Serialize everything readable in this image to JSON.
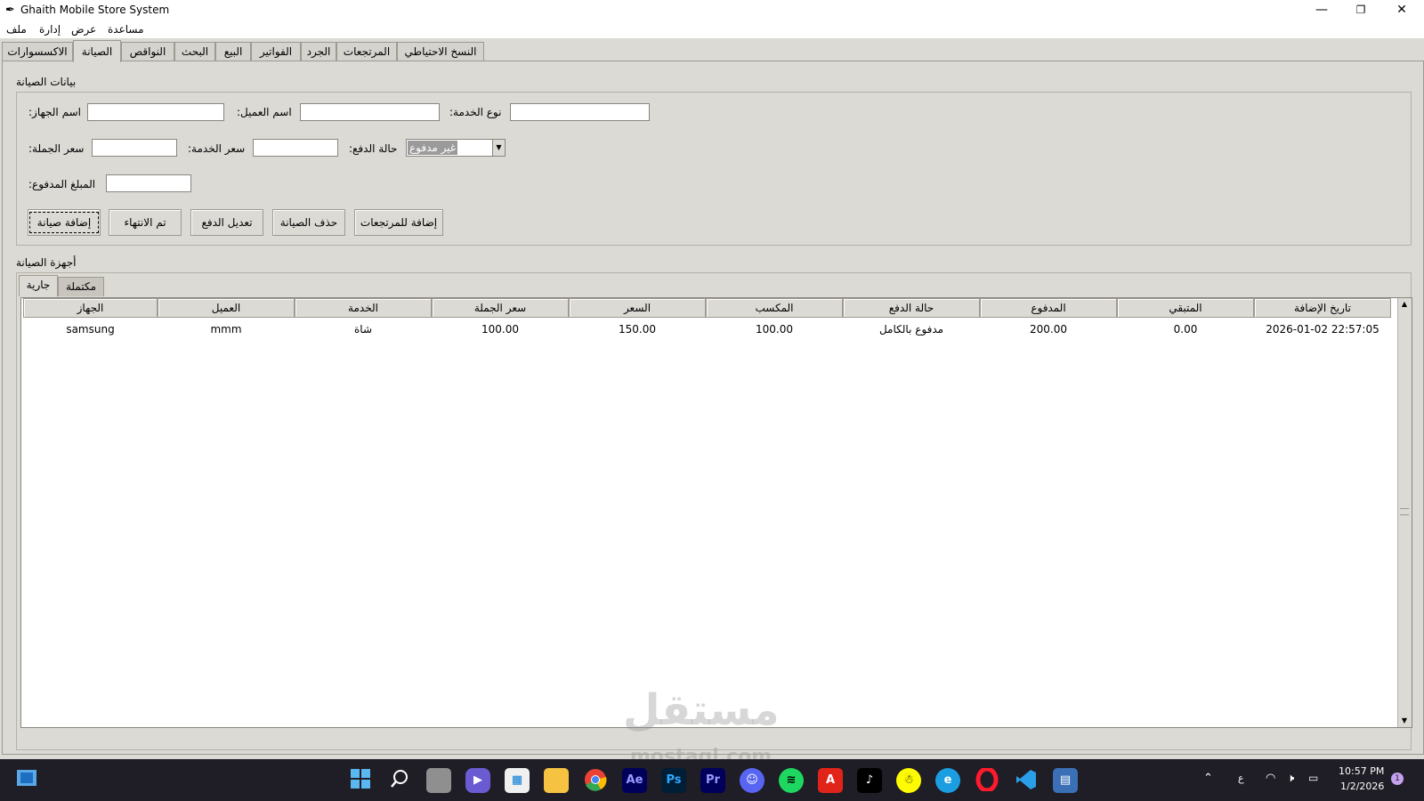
{
  "window": {
    "title": "Ghaith Mobile Store System",
    "app_icon": "feather-icon"
  },
  "window_controls": {
    "minimize": "—",
    "restore": "❐",
    "close": "✕"
  },
  "menu": [
    "ملف",
    "إدارة",
    "عرض",
    "مساعدة"
  ],
  "main_tabs": [
    "الاكسسوارات",
    "الصيانة",
    "النواقص",
    "البحث",
    "البيع",
    "الفواتير",
    "الجرد",
    "المرتجعات",
    "النسخ الاحتياطي"
  ],
  "active_main_tab": "الصيانة",
  "form": {
    "group_title": "بيانات الصيانة",
    "device_name_label": ":اسم الجهاز",
    "customer_name_label": ":اسم العميل",
    "service_type_label": ":نوع الخدمة",
    "wholesale_price_label": ":سعر الجملة",
    "service_price_label": ":سعر الخدمة",
    "payment_status_label": ":حالة الدفع",
    "payment_status_value": "غير مدفوع",
    "amount_paid_label": ":المبلغ المدفوع",
    "device_name_value": "",
    "customer_name_value": "",
    "service_type_value": "",
    "wholesale_price_value": "",
    "service_price_value": "",
    "amount_paid_value": ""
  },
  "buttons": {
    "add_maintenance": "إضافة صيانة",
    "finished": "تم الانتهاء",
    "edit_payment": "تعديل الدفع",
    "delete_maintenance": "حذف الصيانة",
    "add_to_returns": "إضافة للمرتجعات"
  },
  "devices": {
    "group_title": "أجهزة الصيانة",
    "tabs": [
      "جارية",
      "مكتملة"
    ],
    "active_tab": "جارية",
    "columns": [
      "الجهاز",
      "العميل",
      "الخدمة",
      "سعر الجملة",
      "السعر",
      "المكسب",
      "حالة الدفع",
      "المدفوع",
      "المتبقي",
      "تاريخ الإضافة"
    ],
    "rows": [
      [
        "samsung",
        "mmm",
        "شاة",
        "100.00",
        "150.00",
        "100.00",
        "مدفوع بالكامل",
        "200.00",
        "0.00",
        "2026-01-02 22:57:05"
      ]
    ]
  },
  "watermark": {
    "main": "مستقل",
    "sub": "mostaql.com"
  },
  "taskbar": {
    "icons": [
      "windows-start-icon",
      "search-icon",
      "task-view-icon",
      "teams-chat-icon",
      "store-icon",
      "file-explorer-icon",
      "chrome-icon",
      "after-effects-icon",
      "photoshop-icon",
      "premiere-icon",
      "discord-icon",
      "spotify-icon",
      "acrobat-icon",
      "tiktok-icon",
      "snapchat-icon",
      "edge-icon",
      "opera-icon",
      "vscode-icon",
      "python-icon"
    ],
    "icon_labels": {
      "after_effects": "Ae",
      "photoshop": "Ps",
      "premiere": "Pr",
      "acrobat": "A"
    },
    "lang": "ع",
    "time": "10:57 PM",
    "date": "1/2/2026",
    "notification_count": "1"
  }
}
